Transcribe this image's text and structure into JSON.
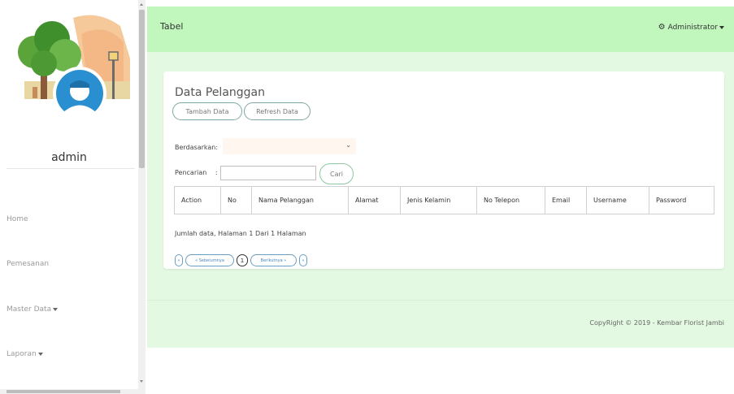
{
  "sidebar": {
    "username": "admin",
    "nav": [
      {
        "label": "Home",
        "dropdown": false
      },
      {
        "label": "Pemesanan",
        "dropdown": false
      },
      {
        "label": "Master Data",
        "dropdown": true
      },
      {
        "label": "Laporan",
        "dropdown": true
      }
    ]
  },
  "header": {
    "title": "Tabel",
    "user_label": "Administrator",
    "user_icon": "gear-icon"
  },
  "card": {
    "title": "Data Pelanggan",
    "add_button": "Tambah Data",
    "refresh_button": "Refresh Data",
    "filter_label": "Berdasarkan:",
    "filter_value": "",
    "search_label": "Pencarian",
    "search_colon": ":",
    "search_value": "",
    "search_button": "Cari",
    "columns": [
      "Action",
      "No",
      "Nama Pelanggan",
      "Alamat",
      "Jenis Kelamin",
      "No Telepon",
      "Email",
      "Username",
      "Password"
    ],
    "summary": "Jumlah data, Halaman 1 Dari 1 Halaman",
    "pagination": {
      "first": "«",
      "prev": "« Sebelumnya",
      "current_page": "1",
      "next": "Berikutnya »",
      "last": "»"
    }
  },
  "footer": {
    "text": "CopyRight © 2019 - Kembar Florist Jambi"
  },
  "colors": {
    "header_bg": "#c1f7bd",
    "content_bg": "#e4f9e1",
    "button_border": "#7fa8a5"
  }
}
